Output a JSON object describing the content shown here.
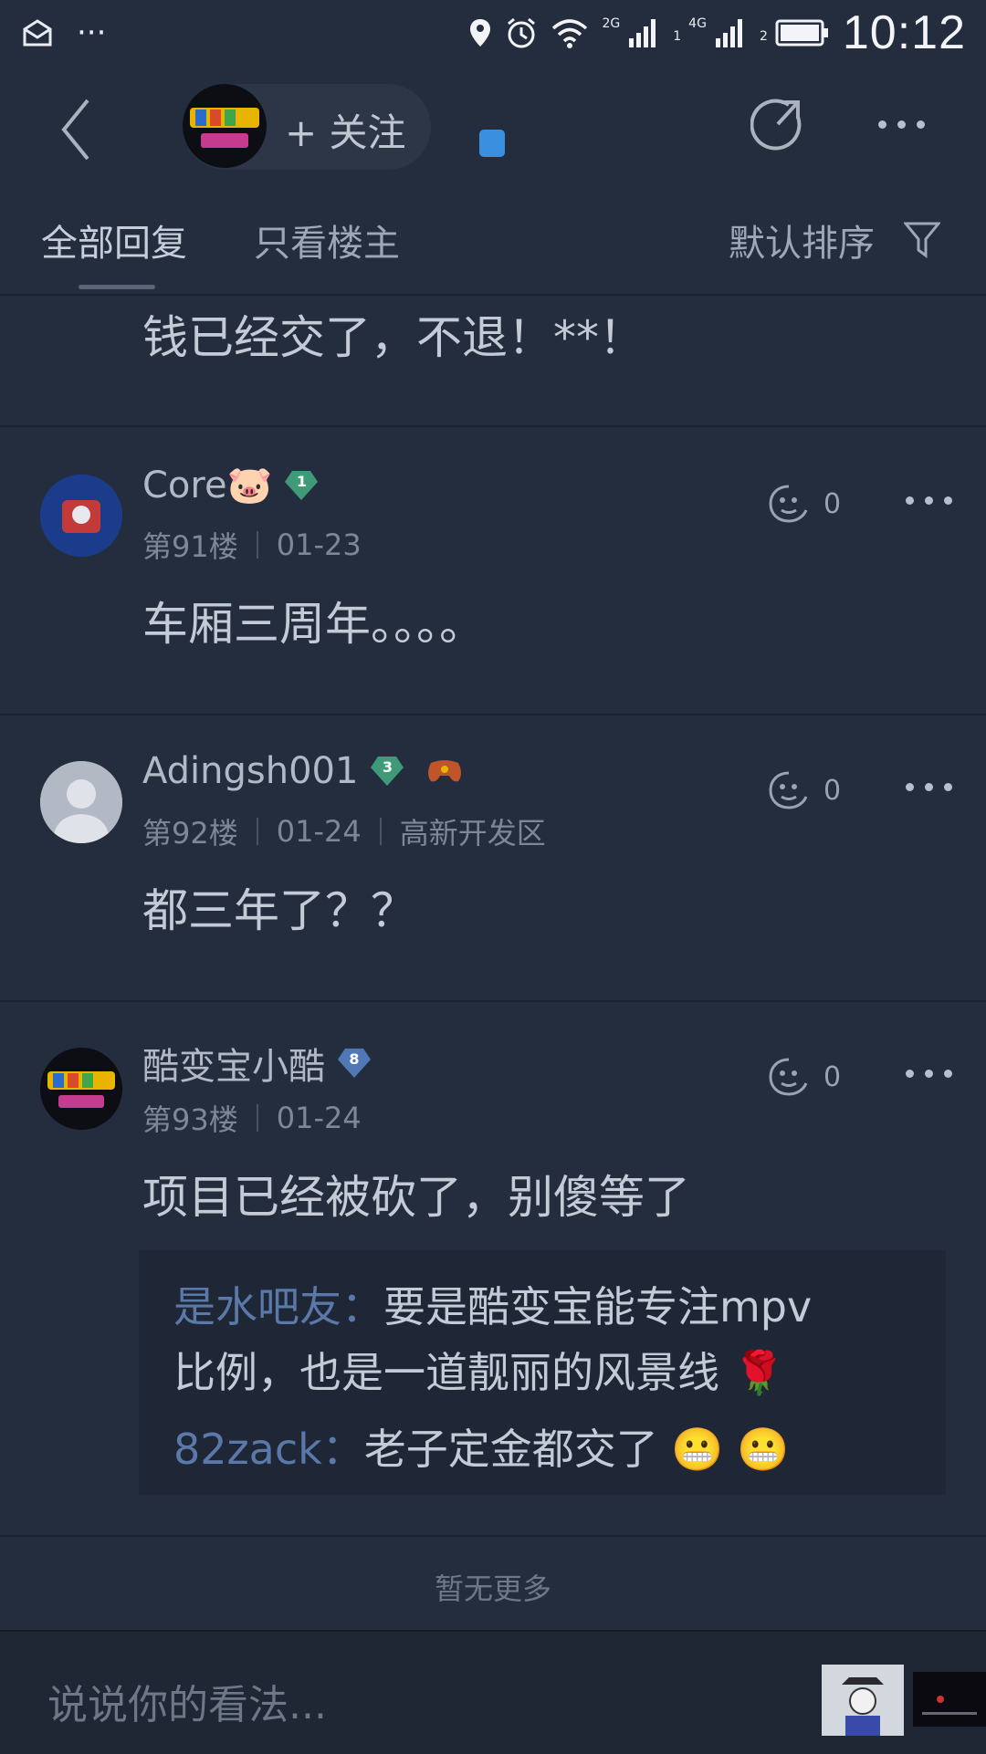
{
  "status_bar": {
    "time": "10:12",
    "net1": "2G",
    "net2": "4G",
    "sim1": "1",
    "sim2": "2"
  },
  "header": {
    "follow_label": "+ 关注"
  },
  "tabs": {
    "all_replies": "全部回复",
    "owner_only": "只看楼主",
    "sort_label": "默认排序"
  },
  "top_fragment": {
    "text": "钱已经交了，不退！**！"
  },
  "posts": [
    {
      "username": "Core🐷",
      "level": "1",
      "floor": "第91楼",
      "date": "01-23",
      "location": "",
      "likes": "0",
      "content": "车厢三周年。。。。"
    },
    {
      "username": "Adingsh001",
      "level": "3",
      "floor": "第92楼",
      "date": "01-24",
      "location": "高新开发区",
      "likes": "0",
      "content": "都三年了？？"
    },
    {
      "username": "酷变宝小酷",
      "level": "8",
      "floor": "第93楼",
      "date": "01-24",
      "location": "",
      "likes": "0",
      "content": "项目已经被砍了，别傻等了"
    }
  ],
  "sub_replies": [
    {
      "user": "是水吧友：",
      "text_line1": "要是酷变宝能专注mpv",
      "text_line2": "比例，也是一道靓丽的风景线 🌹"
    },
    {
      "user": "82zack：",
      "text_line1": "老子定金都交了 😬 😬"
    }
  ],
  "footer": {
    "no_more": "暂无更多",
    "input_placeholder": "说说你的看法..."
  },
  "colors": {
    "background": "#242d3d",
    "gem_green": "#3f9a78",
    "gem_blue": "#4f78b4",
    "reply_user": "#5a78a8"
  }
}
